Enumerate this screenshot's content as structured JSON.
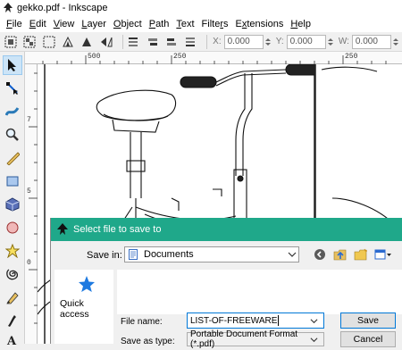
{
  "window": {
    "title": "gekko.pdf - Inkscape"
  },
  "menu": [
    {
      "label": "File",
      "key": "F"
    },
    {
      "label": "Edit",
      "key": "E"
    },
    {
      "label": "View",
      "key": "V"
    },
    {
      "label": "Layer",
      "key": "L"
    },
    {
      "label": "Object",
      "key": "O"
    },
    {
      "label": "Path",
      "key": "P"
    },
    {
      "label": "Text",
      "key": "T"
    },
    {
      "label": "Filters",
      "key": "r"
    },
    {
      "label": "Extensions",
      "key": "x"
    },
    {
      "label": "Help",
      "key": "H"
    }
  ],
  "controls": {
    "x_label": "X:",
    "x_value": "0.000",
    "y_label": "Y:",
    "y_value": "0.000",
    "w_label": "W:",
    "w_value": "0.000"
  },
  "ruler": {
    "h_ticks": [
      "500",
      "250",
      "250"
    ],
    "v_ticks": [
      "7",
      "5",
      "0"
    ]
  },
  "dialog": {
    "title": "Select file to save to",
    "save_in_label": "Save in:",
    "save_in_value": "Documents",
    "quick_access_label": "Quick access",
    "file_name_label": "File name:",
    "file_name_value": "LIST-OF-FREEWARE",
    "save_as_type_label": "Save as type:",
    "save_as_type_value": "Portable Document Format (*.pdf)",
    "save_button": "Save",
    "cancel_button": "Cancel"
  },
  "colors": {
    "dialog_title_bg": "#1fa88a",
    "accent": "#0078d7"
  }
}
